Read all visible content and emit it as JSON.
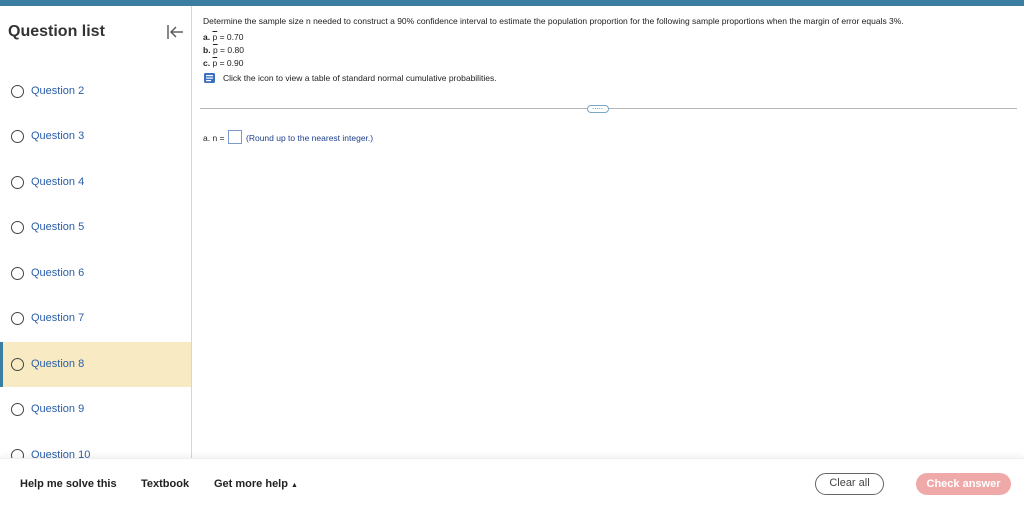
{
  "sidebar": {
    "title": "Question list",
    "questions": [
      {
        "label": "Question 2"
      },
      {
        "label": "Question 3"
      },
      {
        "label": "Question 4"
      },
      {
        "label": "Question 5"
      },
      {
        "label": "Question 6"
      },
      {
        "label": "Question 7"
      },
      {
        "label": "Question 8",
        "active": true
      },
      {
        "label": "Question 9"
      },
      {
        "label": "Question 10"
      }
    ]
  },
  "question": {
    "prompt": "Determine the sample size n needed to construct a 90% confidence interval to estimate the population proportion for the following sample proportions when the margin of error equals 3%.",
    "options": [
      {
        "letter": "a.",
        "symbol": "p",
        "value": "= 0.70"
      },
      {
        "letter": "b.",
        "symbol": "p",
        "value": "= 0.80"
      },
      {
        "letter": "c.",
        "symbol": "p",
        "value": "= 0.90"
      }
    ],
    "table_link": "Click the icon to view a table of standard normal cumulative probabilities.",
    "more_label": "....."
  },
  "answer": {
    "prefix": "a. n =",
    "value": "",
    "hint": "(Round up to the nearest integer.)"
  },
  "footer": {
    "help_solve": "Help me solve this",
    "textbook": "Textbook",
    "more_help": "Get more help",
    "clear_all": "Clear all",
    "check_answer": "Check answer"
  },
  "colors": {
    "accent": "#3b7ea1",
    "active_row": "#f8ebc4",
    "link": "#2a5ea8",
    "check_button": "#f0a9a9"
  }
}
